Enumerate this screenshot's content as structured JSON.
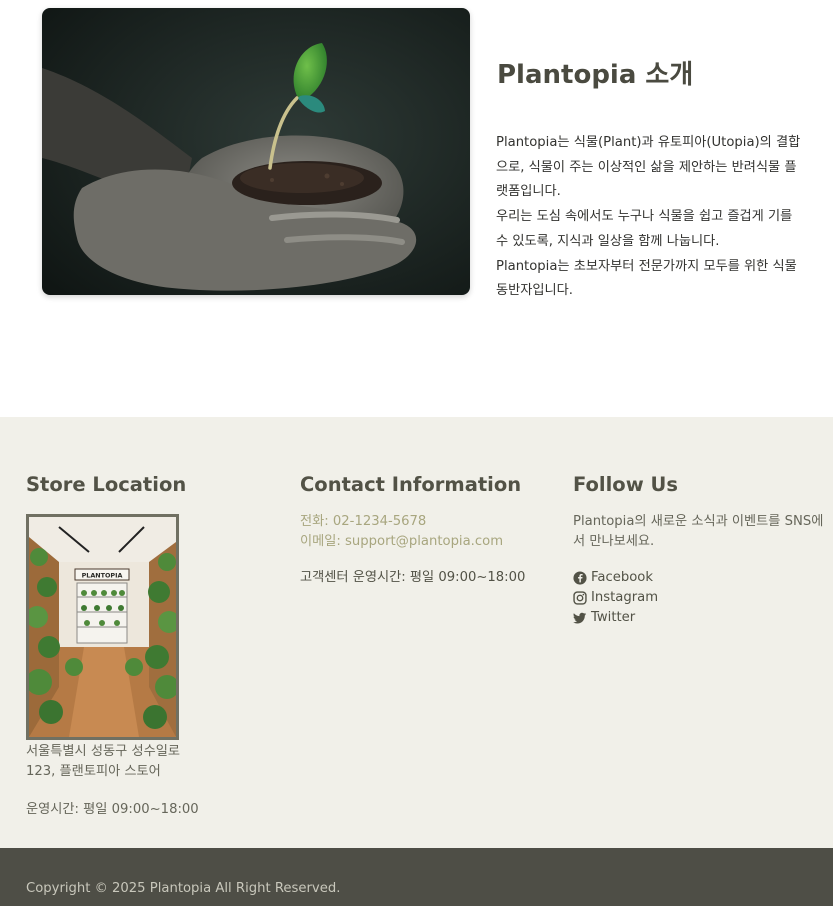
{
  "about": {
    "title": "Plantopia 소개",
    "paragraphs": [
      "Plantopia는 식물(Plant)과 유토피아(Utopia)의 결합으로, 식물이 주는 이상적인 삶을 제안하는 반려식물 플랫폼입니다.",
      "우리는 도심 속에서도 누구나 식물을 쉽고 즐겁게 기를 수 있도록, 지식과 일상을 함께 나눕니다.",
      "Plantopia는 초보자부터 전문가까지 모두를 위한 식물 동반자입니다."
    ],
    "image_icon": "seedling-in-hands-photo"
  },
  "footer": {
    "store": {
      "heading": "Store Location",
      "sign_text": "PLANTOPIA",
      "address": "서울특별시 성동구 성수일로 123, 플랜토피아 스토어",
      "hours": "운영시간: 평일 09:00~18:00"
    },
    "contact": {
      "heading": "Contact Information",
      "phone": "전화: 02-1234-5678",
      "email": "이메일: support@plantopia.com",
      "hours": "고객센터 운영시간: 평일 09:00~18:00"
    },
    "follow": {
      "heading": "Follow Us",
      "description": "Plantopia의 새로운 소식과 이벤트를 SNS에서 만나보세요.",
      "links": [
        {
          "label": "Facebook",
          "icon": "facebook-icon"
        },
        {
          "label": "Instagram",
          "icon": "instagram-icon"
        },
        {
          "label": "Twitter",
          "icon": "twitter-icon"
        }
      ]
    },
    "copyright": "Copyright © 2025 Plantopia All Right Reserved."
  },
  "colors": {
    "footer_bg": "#f1f0e9",
    "copyright_bg": "#4e4e46",
    "heading": "#525246",
    "contact_accent": "#a8a67f"
  }
}
